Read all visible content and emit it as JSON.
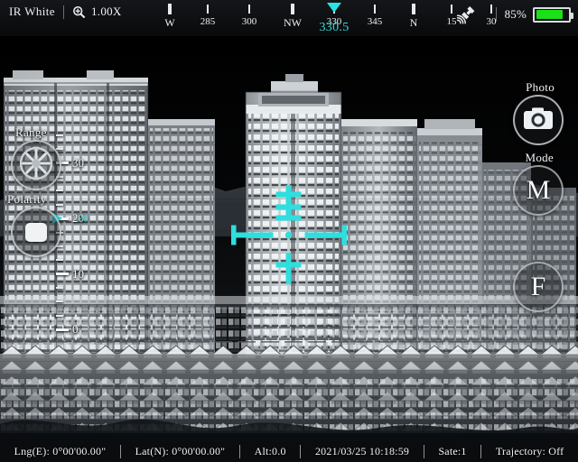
{
  "topbar": {
    "palette_label": "IR White",
    "zoom_icon": "magnifier-icon",
    "zoom_level": "1.00X",
    "satellite_icon": "satellite-icon",
    "battery_percent": "85%",
    "battery_level": 85,
    "battery_color": "#19e019"
  },
  "compass": {
    "heading_value": "330.5",
    "pointer_at": "330",
    "accent_color": "#2fdede",
    "ticks": [
      {
        "label": "W",
        "major": true,
        "pos": 10
      },
      {
        "label": "285",
        "major": false,
        "pos": 52
      },
      {
        "label": "300",
        "major": false,
        "pos": 98
      },
      {
        "label": "NW",
        "major": true,
        "pos": 146
      },
      {
        "label": "330",
        "major": false,
        "pos": 192
      },
      {
        "label": "345",
        "major": false,
        "pos": 237
      },
      {
        "label": "N",
        "major": true,
        "pos": 280
      },
      {
        "label": "15",
        "major": false,
        "pos": 322
      },
      {
        "label": "30",
        "major": false,
        "pos": 366
      }
    ]
  },
  "left_controls": {
    "range_label": "Range",
    "range_icon": "wheel-icon",
    "polarity_label": "Polarity",
    "polarity_icon": "polarity-square-icon"
  },
  "vertical_scale": {
    "unit_ticks": [
      {
        "label": "30",
        "pos": 30
      },
      {
        "label": "20",
        "pos": 20
      },
      {
        "label": "10",
        "pos": 10
      },
      {
        "label": "0",
        "pos": 0
      }
    ],
    "range_min": 0,
    "range_max": 35,
    "pointer_value": 20,
    "pointer_label": "20",
    "accent_color": "#2fdede"
  },
  "right_controls": {
    "photo_label": "Photo",
    "photo_icon": "camera-icon",
    "mode_label": "Mode",
    "mode_button_letter": "M",
    "focus_button_letter": "F"
  },
  "reticle": {
    "color": "#2fdede",
    "name": "crosshair-reticle"
  },
  "statusbar": {
    "longitude": "Lng(E): 0°00'00.00\"",
    "latitude": "Lat(N): 0°00'00.00\"",
    "altitude": "Alt:0.0",
    "datetime": "2021/03/25 10:18:59",
    "satellites": "Sate:1",
    "trajectory": "Trajectory: Off"
  }
}
